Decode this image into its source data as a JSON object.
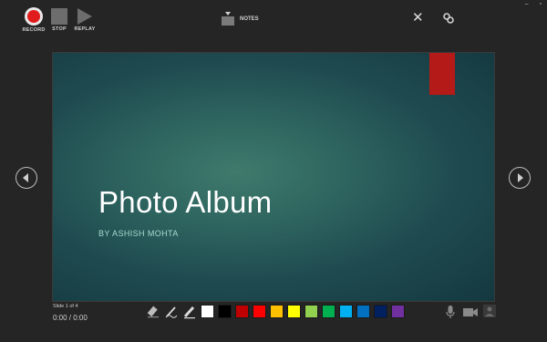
{
  "toolbar": {
    "record_label": "RECORD",
    "stop_label": "STOP",
    "replay_label": "REPLAY",
    "notes_label": "NOTES",
    "close_glyph": "✕",
    "window_controls": {
      "minimize": "–",
      "restore": "▫"
    }
  },
  "slide": {
    "title": "Photo Album",
    "subtitle": "BY ASHISH MOHTA",
    "accent_color": "#b41a17"
  },
  "status": {
    "slide_info": "Slide 1 of 4",
    "timer": "0:00 / 0:00"
  },
  "pen_tools": [
    "eraser-icon",
    "pen-icon",
    "highlighter-icon"
  ],
  "colors": [
    "#ffffff",
    "#000000",
    "#c00000",
    "#ff0000",
    "#ffc000",
    "#ffff00",
    "#92d050",
    "#00b050",
    "#00b0f0",
    "#0070c0",
    "#002060",
    "#7030a0"
  ],
  "bottom_right_icons": [
    "microphone-icon",
    "video-camera-icon",
    "camera-preview-icon"
  ]
}
